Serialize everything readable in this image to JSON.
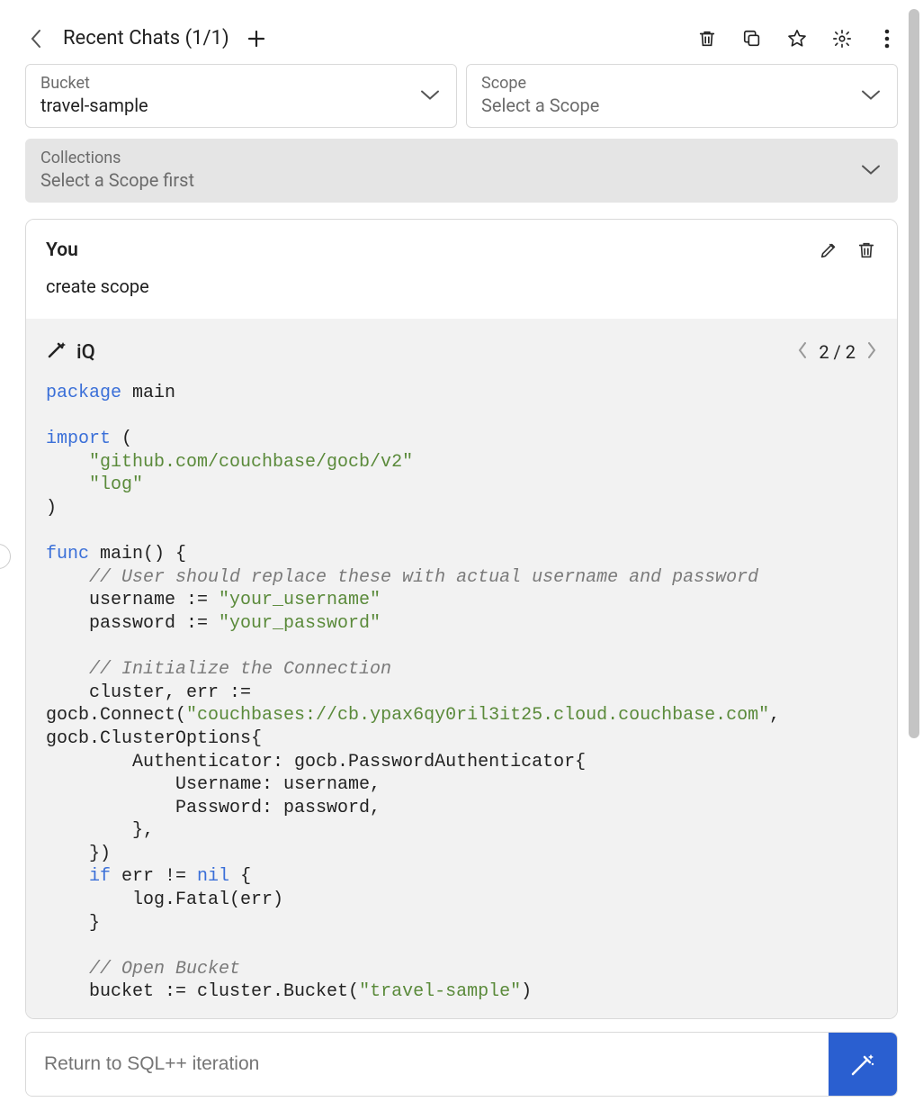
{
  "topbar": {
    "title": "Recent Chats (1/1)"
  },
  "selectors": {
    "bucket": {
      "label": "Bucket",
      "value": "travel-sample"
    },
    "scope": {
      "label": "Scope",
      "placeholder": "Select a Scope"
    },
    "collections": {
      "label": "Collections",
      "placeholder": "Select a Scope first"
    }
  },
  "user_message": {
    "author": "You",
    "text": "create scope"
  },
  "ai_message": {
    "label": "iQ",
    "pager": "2 / 2",
    "code": {
      "l1_kw": "package ",
      "l1_txt": "main",
      "l3_kw": "import ",
      "l3_txt": "(",
      "l4_str": "    \"github.com/couchbase/gocb/v2\"",
      "l5_str": "    \"log\"",
      "l6": ")",
      "l8_kw": "func ",
      "l8_txt": "main() {",
      "l9_cmt": "    // User should replace these with actual username and password",
      "l10a": "    username := ",
      "l10b": "\"your_username\"",
      "l11a": "    password := ",
      "l11b": "\"your_password\"",
      "l13_cmt": "    // Initialize the Connection",
      "l14": "    cluster, err :=",
      "l15a": "gocb.Connect(",
      "l15b": "\"couchbases://cb.ypax6qy0ril3it25.cloud.couchbase.com\"",
      "l15c": ",",
      "l16": "gocb.ClusterOptions{",
      "l17": "        Authenticator: gocb.PasswordAuthenticator{",
      "l18": "            Username: username,",
      "l19": "            Password: password,",
      "l20": "        },",
      "l21": "    })",
      "l22a": "    ",
      "l22b": "if ",
      "l22c": "err != ",
      "l22d": "nil ",
      "l22e": "{",
      "l23": "        log.Fatal(err)",
      "l24": "    }",
      "l26_cmt": "    // Open Bucket",
      "l27a": "    bucket := cluster.Bucket(",
      "l27b": "\"travel-sample\"",
      "l27c": ")"
    }
  },
  "input": {
    "placeholder": "Return to SQL++ iteration"
  }
}
